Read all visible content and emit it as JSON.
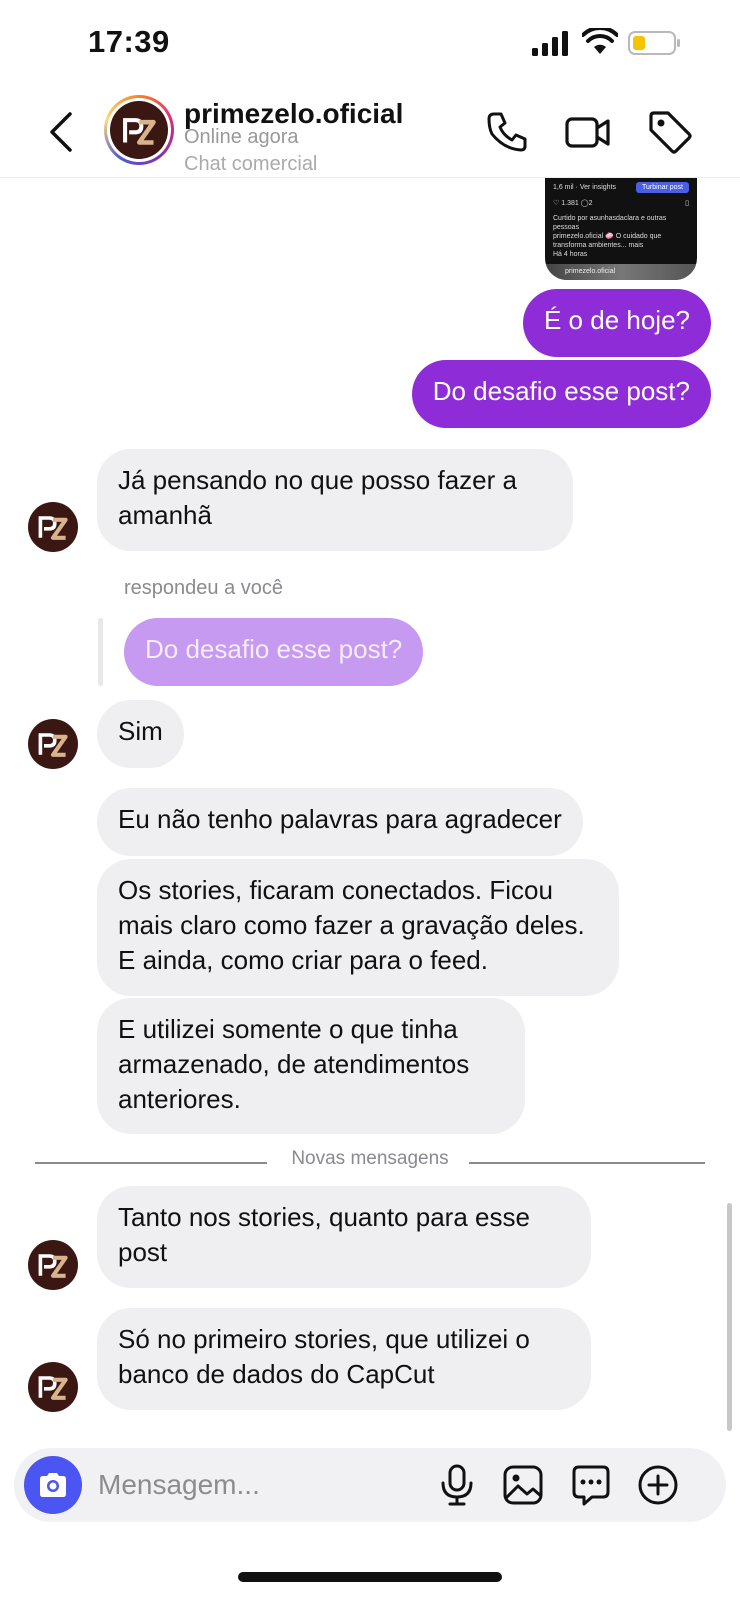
{
  "status_bar": {
    "time": "17:39",
    "battery_color": "#f4c400"
  },
  "header": {
    "name": "primezelo.oficial",
    "status": "Online agora",
    "subtitle": "Chat comercial",
    "back_icon": "chevron-left-icon",
    "actions": [
      "phone-icon",
      "video-icon",
      "tag-icon"
    ]
  },
  "post_preview": {
    "insights": "1,6 mil · Ver insights",
    "boost": "Turbinar post",
    "likes": "1.381",
    "comments": "2",
    "liked_by": "Curtido por asunhasdaclara e outras pessoas",
    "caption": "primezelo.oficial 🧼 O cuidado que transforma ambientes... mais",
    "time": "Há 4 horas",
    "next_caption": "primezelo.oficial"
  },
  "messages": {
    "out_1": "É o de hoje?",
    "out_2": "Do desafio esse post?",
    "in_1": "Já pensando no que posso fazer a amanhã",
    "reply_meta": "respondeu a você",
    "reply_quote": "Do desafio esse post?",
    "in_2": "Sim",
    "in_3": "Eu não tenho palavras para agradecer",
    "in_4": "Os stories, ficaram conectados. Ficou mais claro como fazer a gravação deles. E ainda, como criar para o feed.",
    "in_5": "E utilizei somente o que tinha armazenado, de atendimentos anteriores.",
    "new_messages_label": "Novas mensagens",
    "in_6": "Tanto nos stories, quanto para esse post",
    "in_7": "Só no primeiro stories, que utilizei o banco de dados do CapCut"
  },
  "composer": {
    "placeholder": "Mensagem...",
    "value": "",
    "icons": [
      "camera-icon",
      "microphone-icon",
      "gallery-icon",
      "sticker-icon",
      "plus-icon"
    ]
  },
  "colors": {
    "outgoing": "#8e2cd8",
    "incoming": "#efeff2",
    "camera_button": "#4a55f2"
  }
}
